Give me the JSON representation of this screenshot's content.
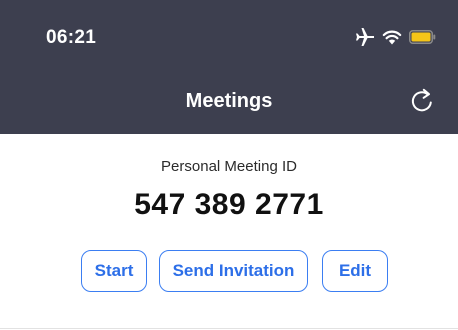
{
  "status_bar": {
    "time": "06:21",
    "icons": [
      "airplane-mode-icon",
      "wifi-icon",
      "battery-icon"
    ],
    "battery_color": "#f5c518"
  },
  "nav": {
    "title": "Meetings",
    "right_icon": "refresh-icon"
  },
  "meeting": {
    "label": "Personal Meeting ID",
    "id": "547 389 2771"
  },
  "actions": {
    "start": "Start",
    "send_invitation": "Send Invitation",
    "edit": "Edit"
  },
  "colors": {
    "header_bg": "#3d3f4f",
    "accent": "#2d6fe8"
  }
}
